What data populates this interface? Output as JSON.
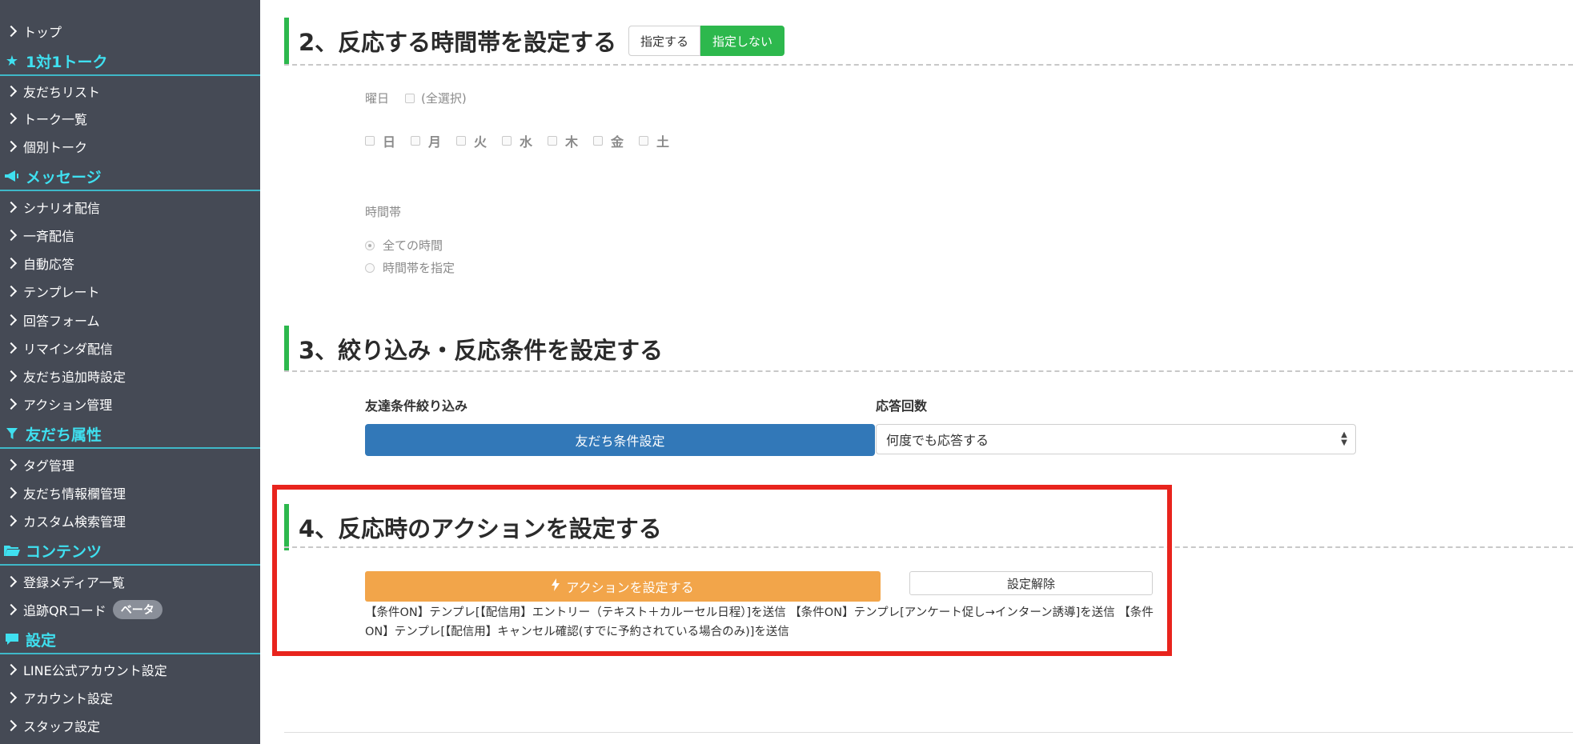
{
  "sidebar": {
    "top": "トップ",
    "section_talk": "1対1トーク",
    "talk_items": [
      "友だちリスト",
      "トーク一覧",
      "個別トーク"
    ],
    "section_message": "メッセージ",
    "message_items": [
      "シナリオ配信",
      "一斉配信",
      "自動応答",
      "テンプレート",
      "回答フォーム",
      "リマインダ配信",
      "友だち追加時設定",
      "アクション管理"
    ],
    "section_attr": "友だち属性",
    "attr_items": [
      "タグ管理",
      "友だち情報欄管理",
      "カスタム検索管理"
    ],
    "section_contents": "コンテンツ",
    "contents_items": [
      "登録メディア一覧",
      "追跡QRコード"
    ],
    "beta_badge": "ベータ",
    "section_settings": "設定",
    "settings_items": [
      "LINE公式アカウント設定",
      "アカウント設定",
      "スタッフ設定"
    ],
    "icons": {
      "talk": "star-icon",
      "message": "megaphone-icon",
      "attr": "filter-icon",
      "contents": "folder-icon",
      "settings": "speech-bubble-icon"
    }
  },
  "section2": {
    "title": "2、反応する時間帯を設定する",
    "toggle_on": "指定する",
    "toggle_off": "指定しない",
    "weekday_label": "曜日",
    "select_all": "(全選択)",
    "days": [
      "日",
      "月",
      "火",
      "水",
      "木",
      "金",
      "土"
    ],
    "timeband_label": "時間帯",
    "option_all": "全ての時間",
    "option_specify": "時間帯を指定"
  },
  "section3": {
    "title": "3、絞り込み・反応条件を設定する",
    "filter_label": "友達条件絞り込み",
    "filter_button": "友だち条件設定",
    "count_label": "応答回数",
    "count_value": "何度でも応答する"
  },
  "section4": {
    "title": "4、反応時のアクションを設定する",
    "action_button": "アクションを設定する",
    "clear_button": "設定解除",
    "action_desc": "【条件ON】テンプレ[【配信用】エントリー（テキスト＋カルーセル日程）]を送信 【条件ON】テンプレ[アンケート促し→インターン誘導]を送信 【条件ON】テンプレ[【配信用】キャンセル確認(すでに予約されている場合のみ)]を送信"
  },
  "colors": {
    "sidebar_bg": "#454a55",
    "accent_cyan": "#3fe0f0",
    "accent_green": "#2db84d",
    "button_blue": "#3278b8",
    "button_orange": "#f2a54a",
    "highlight_red": "#e8241d"
  }
}
